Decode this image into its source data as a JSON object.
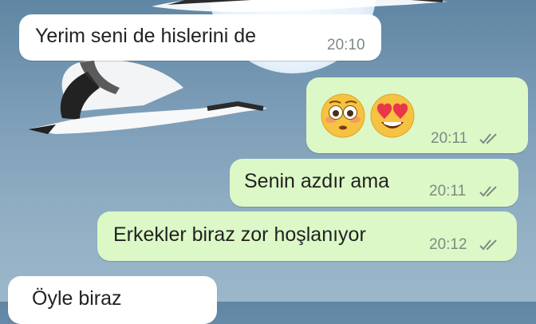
{
  "chat": {
    "colors": {
      "incoming_bubble": "#ffffff",
      "outgoing_bubble": "#dcf8c6",
      "read_ticks": "#7d8a84"
    },
    "wallpaper": {
      "icons": [
        "moon",
        "flying-crane-bird",
        "flying-crane-bird"
      ]
    },
    "messages": [
      {
        "direction": "incoming",
        "text": "Yerim seni de hislerini de",
        "time": "20:10"
      },
      {
        "direction": "outgoing",
        "emojis": [
          "flushed-face-emoji",
          "heart-eyes-emoji"
        ],
        "time": "20:11",
        "status": "read-double-check"
      },
      {
        "direction": "outgoing",
        "text": "Senin azdır ama",
        "time": "20:11",
        "status": "read-double-check"
      },
      {
        "direction": "outgoing",
        "text": "Erkekler biraz zor hoşlanıyor",
        "time": "20:12",
        "status": "read-double-check"
      },
      {
        "direction": "incoming",
        "text": "Öyle biraz",
        "time": ""
      }
    ]
  }
}
